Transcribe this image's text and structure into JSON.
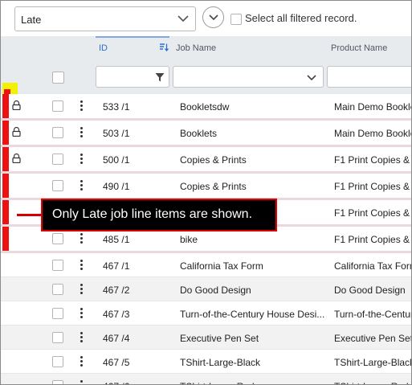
{
  "filter": {
    "selected": "Late"
  },
  "select_all": {
    "label": "Select all filtered record."
  },
  "columns": {
    "id": "ID",
    "job_name": "Job Name",
    "product_name": "Product Name"
  },
  "callout": {
    "text": "Only Late job line items are shown."
  },
  "colors": {
    "late_flag": "#ee1111",
    "highlight": "#f2f200",
    "callout_bg": "#000000",
    "callout_border": "#e00000",
    "header_bg": "#e8ebee",
    "accent": "#2a6fcf"
  },
  "rows": [
    {
      "id": "533 /1",
      "job": "Bookletsdw",
      "product": "Main Demo Booklet",
      "locked": true,
      "late": true
    },
    {
      "id": "503 /1",
      "job": "Booklets",
      "product": "Main Demo Booklet",
      "locked": true,
      "late": true
    },
    {
      "id": "500 /1",
      "job": "Copies & Prints",
      "product": "F1 Print Copies & Pr",
      "locked": true,
      "late": true
    },
    {
      "id": "490 /1",
      "job": "Copies & Prints",
      "product": "F1 Print Copies & Pr",
      "locked": false,
      "late": true
    },
    {
      "id": "",
      "job": "",
      "product": "F1 Print Copies & Pr",
      "locked": false,
      "late": true
    },
    {
      "id": "485 /1",
      "job": "bike",
      "product": "F1 Print Copies & Pr",
      "locked": false,
      "late": true
    },
    {
      "id": "467 /1",
      "job": "California Tax Form",
      "product": "California Tax Form",
      "locked": false,
      "late": false
    },
    {
      "id": "467 /2",
      "job": "Do Good Design",
      "product": "Do Good Design",
      "locked": false,
      "late": false
    },
    {
      "id": "467 /3",
      "job": "Turn-of-the-Century House Desi...",
      "product": "Turn-of-the-Centur",
      "locked": false,
      "late": false
    },
    {
      "id": "467 /4",
      "job": "Executive Pen Set",
      "product": "Executive Pen Set",
      "locked": false,
      "late": false
    },
    {
      "id": "467 /5",
      "job": "TShirt-Large-Black",
      "product": "TShirt-Large-Black",
      "locked": false,
      "late": false
    },
    {
      "id": "467 /6",
      "job": "TShirt-Large-Red",
      "product": "TShirt-Large-Red",
      "locked": false,
      "late": false
    }
  ]
}
